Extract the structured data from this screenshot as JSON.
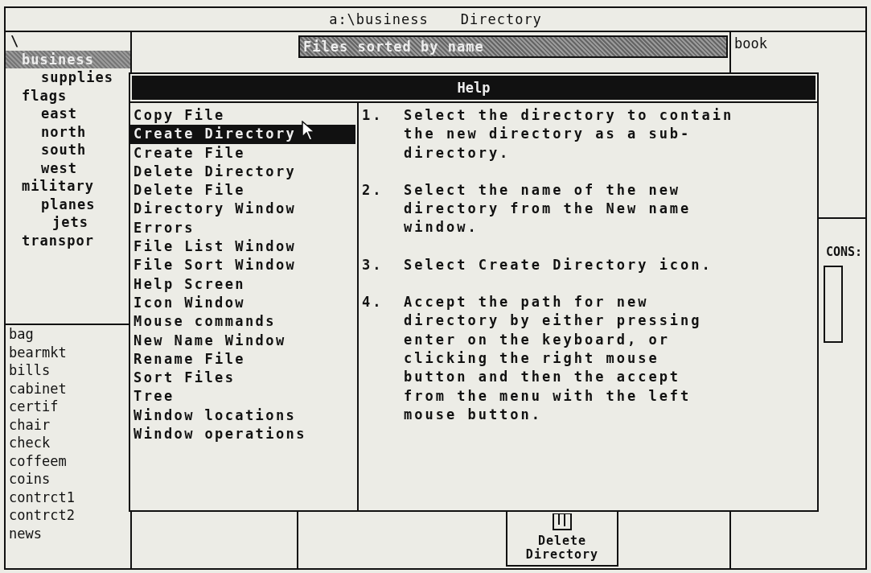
{
  "title_bar": {
    "path": "a:\\business",
    "title": "Directory"
  },
  "tree": {
    "label": "\\",
    "children": [
      {
        "label": "business",
        "selected": true,
        "children": [
          {
            "label": "supplies",
            "selected": false
          }
        ]
      },
      {
        "label": "flags",
        "selected": false,
        "children": [
          {
            "label": "east",
            "selected": false
          },
          {
            "label": "north",
            "selected": false
          },
          {
            "label": "south",
            "selected": false
          },
          {
            "label": "west",
            "selected": false
          }
        ]
      },
      {
        "label": "military",
        "selected": false,
        "children": [
          {
            "label": "planes",
            "selected": false,
            "children": [
              {
                "label": "jets",
                "selected": false
              }
            ]
          }
        ]
      },
      {
        "label": "transpor",
        "selected": false
      }
    ]
  },
  "file_list": [
    "bag",
    "bearmkt",
    "bills",
    "cabinet",
    "certif",
    "chair",
    "check",
    "coffeem",
    "coins",
    "contrct1",
    "contrct2",
    "news"
  ],
  "sort_window": {
    "header": "Files sorted by name"
  },
  "right_file_list": [
    "book"
  ],
  "icons_window": {
    "label": "CONS:",
    "delete_icon_label": "Delete Directory"
  },
  "help": {
    "title": "Help",
    "topics": [
      {
        "label": "Copy File",
        "selected": false
      },
      {
        "label": "Create Directory",
        "selected": true
      },
      {
        "label": "Create File",
        "selected": false
      },
      {
        "label": "Delete Directory",
        "selected": false
      },
      {
        "label": "Delete File",
        "selected": false
      },
      {
        "label": "Directory Window",
        "selected": false
      },
      {
        "label": "Errors",
        "selected": false
      },
      {
        "label": "File List Window",
        "selected": false
      },
      {
        "label": "File Sort Window",
        "selected": false
      },
      {
        "label": "Help Screen",
        "selected": false
      },
      {
        "label": "Icon Window",
        "selected": false
      },
      {
        "label": "Mouse commands",
        "selected": false
      },
      {
        "label": "New Name Window",
        "selected": false
      },
      {
        "label": "Rename File",
        "selected": false
      },
      {
        "label": "Sort Files",
        "selected": false
      },
      {
        "label": "Tree",
        "selected": false
      },
      {
        "label": "Window locations",
        "selected": false
      },
      {
        "label": "Window operations",
        "selected": false
      }
    ],
    "steps": [
      {
        "number": "1.",
        "text": "Select the directory to contain\nthe new directory as a sub-\ndirectory."
      },
      {
        "number": "2.",
        "text": "Select the name of the new\ndirectory from the New name\nwindow."
      },
      {
        "number": "3.",
        "text": "Select Create Directory icon."
      },
      {
        "number": "4.",
        "text": "Accept the path for new\ndirectory by either pressing\nenter on the keyboard, or\nclicking the right mouse\nbutton and then the accept\nfrom the menu with the left\nmouse button."
      }
    ]
  }
}
